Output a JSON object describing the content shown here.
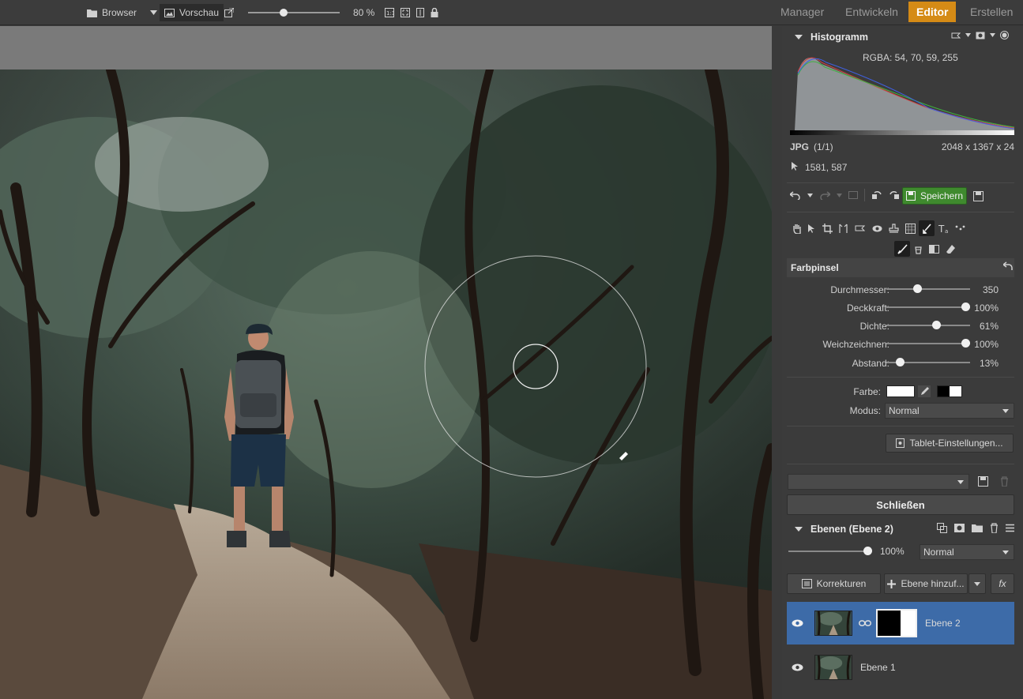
{
  "toolbar": {
    "browser_label": "Browser",
    "preview_label": "Vorschau",
    "zoom_value": "80 %",
    "zoom_slider_fraction": 0.38
  },
  "tabs": [
    {
      "label": "Manager"
    },
    {
      "label": "Entwickeln"
    },
    {
      "label": "Editor",
      "active": true
    },
    {
      "label": "Erstellen"
    }
  ],
  "histogram": {
    "title": "Histogramm",
    "rgba": "RGBA:  54,  70,  59, 255",
    "format": "JPG",
    "count": "(1/1)",
    "dimensions": "2048 x 1367 x 24",
    "cursor_pos": "1581, 587"
  },
  "actions": {
    "save_label": "Speichern"
  },
  "brush": {
    "title": "Farbpinsel",
    "params": [
      {
        "label": "Durchmesser:",
        "value": "350",
        "fraction": 0.36
      },
      {
        "label": "Deckkraft:",
        "value": "100%",
        "fraction": 1.0
      },
      {
        "label": "Dichte:",
        "value": "61%",
        "fraction": 0.61
      },
      {
        "label": "Weichzeichnen:",
        "value": "100%",
        "fraction": 1.0
      },
      {
        "label": "Abstand:",
        "value": "13%",
        "fraction": 0.13
      }
    ],
    "color_label": "Farbe:",
    "mode_label": "Modus:",
    "mode_value": "Normal",
    "tablet_button": "Tablet-Einstellungen..."
  },
  "close_button": "Schließen",
  "layers": {
    "title": "Ebenen (Ebene 2)",
    "opacity": "100%",
    "opacity_fraction": 1.0,
    "blend_mode": "Normal",
    "corrections_button": "Korrekturen",
    "add_layer_button": "Ebene hinzuf...",
    "fx_button": "fx",
    "items": [
      {
        "name": "Ebene 2",
        "selected": true
      },
      {
        "name": "Ebene 1",
        "selected": false
      }
    ]
  },
  "colors": {
    "accent_tab": "#d58b16",
    "save_green": "#3f8a2e",
    "layer_selected": "#3d6ba8"
  }
}
